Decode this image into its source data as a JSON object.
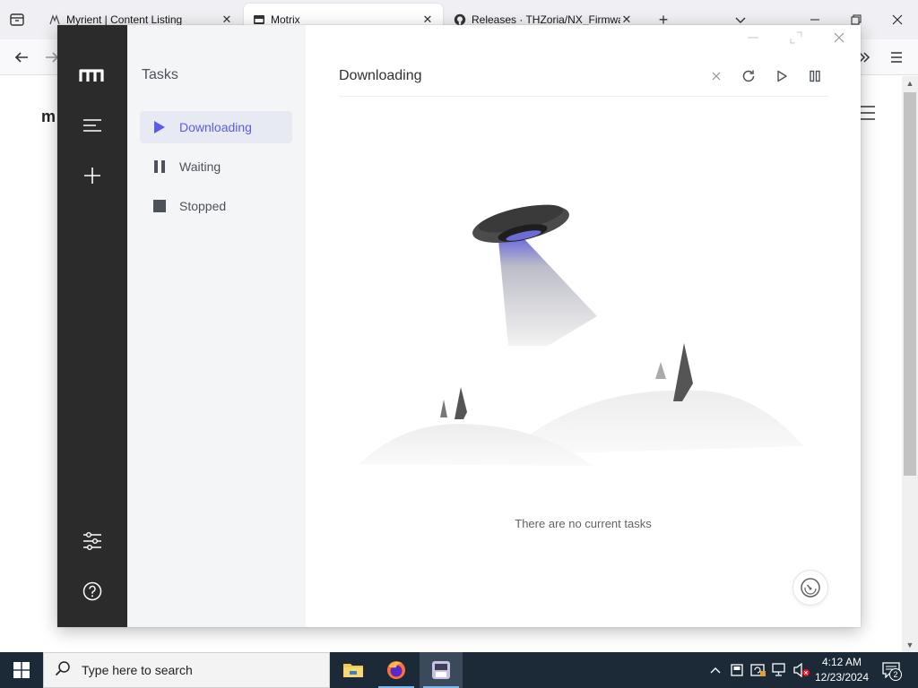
{
  "browser": {
    "tabs": [
      {
        "title": "Myrient | Content Listing",
        "icon": "myrient-favicon-icon",
        "active": false
      },
      {
        "title": "Motrix",
        "icon": "motrix-favicon-icon",
        "active": true
      },
      {
        "title": "Releases · THZoria/NX_Firmware",
        "icon": "github-icon",
        "active": false
      }
    ],
    "new_tab": "+",
    "close_glyph": "✕",
    "page_logo_fragment": "m"
  },
  "motrix": {
    "sidebar_title": "Tasks",
    "nav": [
      {
        "label": "Downloading",
        "icon": "play-icon",
        "active": true
      },
      {
        "label": "Waiting",
        "icon": "pause-icon",
        "active": false
      },
      {
        "label": "Stopped",
        "icon": "stop-icon",
        "active": false
      }
    ],
    "header_title": "Downloading",
    "empty_text": "There are no current tasks",
    "accent_color": "#5b5bea",
    "sidebar_color": "#2b2b2b"
  },
  "taskbar": {
    "search_placeholder": "Type here to search",
    "time": "4:12 AM",
    "date": "12/23/2024",
    "notification_count": "2"
  }
}
